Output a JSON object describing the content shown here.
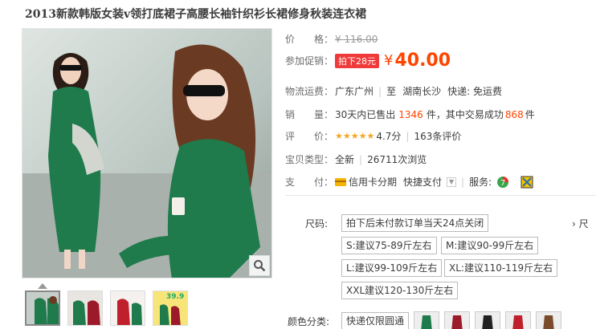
{
  "product": {
    "title": "2013新款韩版女装v领打底裙子高腰长袖针织衫长裙修身秋装连衣裙"
  },
  "gallery": {
    "thumb_count": 4,
    "thumb4_label": "39.9"
  },
  "props": {
    "price_label": "价　　格：",
    "original_price": "¥ 116.00",
    "promo_label": "参加促销：",
    "promo_tag": "拍下28元",
    "promo_currency": "¥",
    "promo_price": "40.00",
    "ship_label": "物流运费：",
    "ship_from": "广东广州",
    "ship_to_prefix": "至",
    "ship_to": "湖南长沙",
    "ship_note": "快递: 免运费",
    "sales_label": "销　　量：",
    "sales_prefix": "30天内已售出",
    "sales_count": "1346",
    "sales_mid": "件，其中交易成功",
    "sales_success": "868",
    "sales_suffix": "件",
    "rating_label": "评　　价：",
    "rating_stars": "★★★★★",
    "rating_score": "4.7分",
    "rating_count": "163条评价",
    "type_label": "宝贝类型：",
    "type_value": "全新",
    "views": "26711次浏览",
    "pay_label": "支　　付：",
    "pay_credit": "信用卡分期",
    "pay_quick": "快捷支付",
    "service_label": "服务:"
  },
  "sku": {
    "size_label": "尺码:",
    "sizes": [
      "拍下后未付款订单当天24点关闭",
      "S:建议75-89斤左右",
      "M:建议90-99斤左右",
      "L:建议99-109斤左右",
      "XL:建议110-119斤左右",
      "XXL建议120-130斤左右"
    ],
    "more": "› 尺",
    "color_label": "颜色分类:",
    "color_first": "快递仅限圆通"
  },
  "colors": {
    "price_accent": "#ff4400",
    "promo_bg": "#f03a3a",
    "dress_green": "#1f7a4c"
  }
}
